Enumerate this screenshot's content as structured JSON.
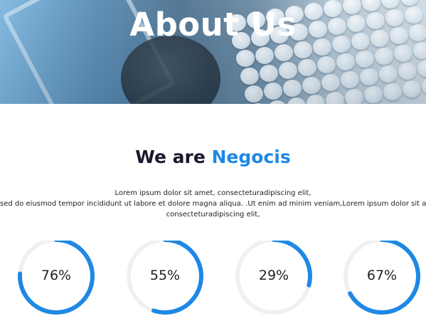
{
  "hero": {
    "title": "About Us"
  },
  "section": {
    "heading_prefix": "We are",
    "heading_accent": "Negocis",
    "accent_color": "#1e88e5",
    "paragraph_lines": [
      "Lorem ipsum dolor sit amet, consecteturadipiscing elit,",
      "sed do eiusmod tempor incididunt ut labore et dolore magna aliqua. .Ut enim ad minim veniam,Lorem ipsum dolor sit amet,",
      "consecteturadipiscing elit,"
    ]
  },
  "stats": [
    {
      "label": "76%",
      "percent": 76
    },
    {
      "label": "55%",
      "percent": 55
    },
    {
      "label": "29%",
      "percent": 29
    },
    {
      "label": "67%",
      "percent": 67
    }
  ],
  "colors": {
    "progress": "#1e88e5",
    "track": "#eef1f4"
  }
}
